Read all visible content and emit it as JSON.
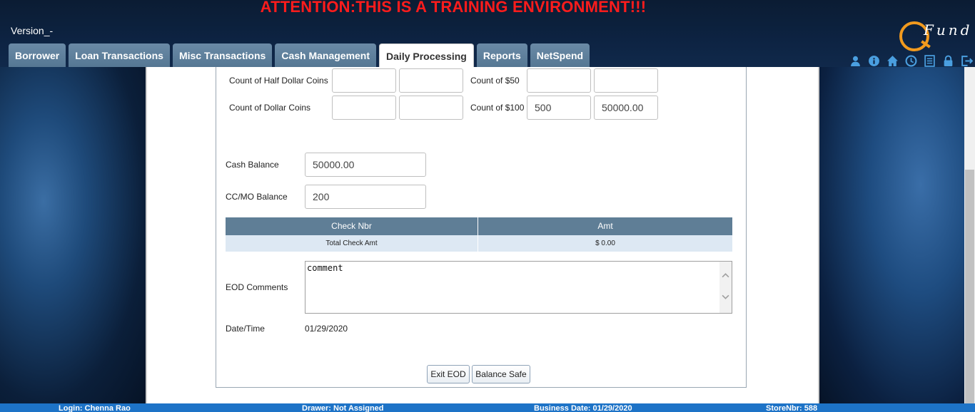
{
  "header": {
    "attention": "ATTENTION:THIS IS A TRAINING ENVIRONMENT!!!",
    "version": "Version_-",
    "logo_text": "Fund"
  },
  "tabs": [
    {
      "label": "Borrower"
    },
    {
      "label": "Loan Transactions"
    },
    {
      "label": "Misc Transactions"
    },
    {
      "label": "Cash Management"
    },
    {
      "label": "Daily Processing",
      "active": true
    },
    {
      "label": "Reports"
    },
    {
      "label": "NetSpend"
    }
  ],
  "toolbar_icons": [
    "user-icon",
    "info-icon",
    "home-icon",
    "clock-icon",
    "notes-icon",
    "lock-icon",
    "logout-icon"
  ],
  "coins": {
    "half_dollar_label": "Count of Half Dollar Coins",
    "half_dollar_count": "",
    "half_dollar_amount": "",
    "dollar_label": "Count of Dollar Coins",
    "dollar_count": "",
    "dollar_amount": ""
  },
  "bills": {
    "fifty_label": "Count of $50",
    "fifty_count": "",
    "fifty_amount": "",
    "hundred_label": "Count of $100",
    "hundred_count": "500",
    "hundred_amount": "50000.00"
  },
  "balances": {
    "cash_label": "Cash Balance",
    "cash_value": "50000.00",
    "ccmo_label": "CC/MO Balance",
    "ccmo_value": "200"
  },
  "check_table": {
    "headers": [
      "Check Nbr",
      "Amt"
    ],
    "total_label": "Total Check Amt",
    "total_amount": "$ 0.00"
  },
  "eod": {
    "comments_label": "EOD Comments",
    "comments_value": "comment",
    "datetime_label": "Date/Time",
    "datetime_value": "01/29/2020"
  },
  "buttons": {
    "exit_eod": "Exit EOD",
    "balance_safe": "Balance Safe"
  },
  "status": {
    "login": "Login: Chenna Rao",
    "drawer": "Drawer: Not Assigned",
    "business_date": "Business Date: 01/29/2020",
    "store": "StoreNbr: 588"
  },
  "colors": {
    "attention": "#ff1c1c",
    "tab": "#5f7e96",
    "status_bar": "#1d73c7",
    "logo_accent": "#f19a1e"
  }
}
